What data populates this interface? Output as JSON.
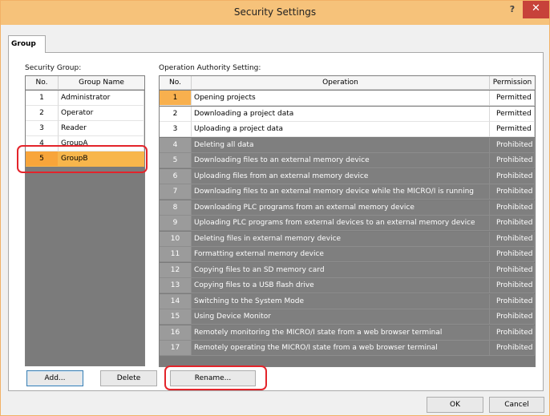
{
  "window": {
    "title": "Security Settings",
    "help_label": "?",
    "close_label": "✕"
  },
  "tab": {
    "label": "Group"
  },
  "security_group": {
    "label": "Security Group:",
    "headers": {
      "no": "No.",
      "name": "Group Name"
    },
    "rows": [
      {
        "no": "1",
        "name": "Administrator"
      },
      {
        "no": "2",
        "name": "Operator"
      },
      {
        "no": "3",
        "name": "Reader"
      },
      {
        "no": "4",
        "name": "GroupA"
      },
      {
        "no": "5",
        "name": "GroupB"
      }
    ],
    "selected_no": "5"
  },
  "authority": {
    "label": "Operation Authority Setting:",
    "headers": {
      "no": "No.",
      "operation": "Operation",
      "permission": "Permission"
    },
    "rows": [
      {
        "no": "1",
        "operation": "Opening projects",
        "permission": "Permitted"
      },
      {
        "no": "2",
        "operation": "Downloading a project data",
        "permission": "Permitted"
      },
      {
        "no": "3",
        "operation": "Uploading a project data",
        "permission": "Permitted"
      },
      {
        "no": "4",
        "operation": "Deleting all data",
        "permission": "Prohibited"
      },
      {
        "no": "5",
        "operation": "Downloading files to an external memory device",
        "permission": "Prohibited"
      },
      {
        "no": "6",
        "operation": "Uploading files from an external memory device",
        "permission": "Prohibited"
      },
      {
        "no": "7",
        "operation": "Downloading files to an external memory device while the MICRO/I is running",
        "permission": "Prohibited"
      },
      {
        "no": "8",
        "operation": "Downloading PLC programs from an external memory device",
        "permission": "Prohibited"
      },
      {
        "no": "9",
        "operation": "Uploading PLC programs from external devices to an external memory device",
        "permission": "Prohibited"
      },
      {
        "no": "10",
        "operation": "Deleting files in external memory device",
        "permission": "Prohibited"
      },
      {
        "no": "11",
        "operation": "Formatting external memory device",
        "permission": "Prohibited"
      },
      {
        "no": "12",
        "operation": "Copying files to an SD memory card",
        "permission": "Prohibited"
      },
      {
        "no": "13",
        "operation": "Copying files to a USB flash drive",
        "permission": "Prohibited"
      },
      {
        "no": "14",
        "operation": "Switching to the System Mode",
        "permission": "Prohibited"
      },
      {
        "no": "15",
        "operation": "Using Device Monitor",
        "permission": "Prohibited"
      },
      {
        "no": "16",
        "operation": "Remotely monitoring the MICRO/I state from a web browser terminal",
        "permission": "Prohibited"
      },
      {
        "no": "17",
        "operation": "Remotely operating the MICRO/I state from a web browser terminal",
        "permission": "Prohibited"
      }
    ]
  },
  "buttons": {
    "add": "Add...",
    "delete": "Delete",
    "rename": "Rename...",
    "ok": "OK",
    "cancel": "Cancel"
  },
  "colors": {
    "titlebar": "#f6c27a",
    "selection": "#f7b64c",
    "prohibited_row": "#7f7f7f",
    "close_button": "#c7423a",
    "callout_outline": "#e3242b"
  }
}
